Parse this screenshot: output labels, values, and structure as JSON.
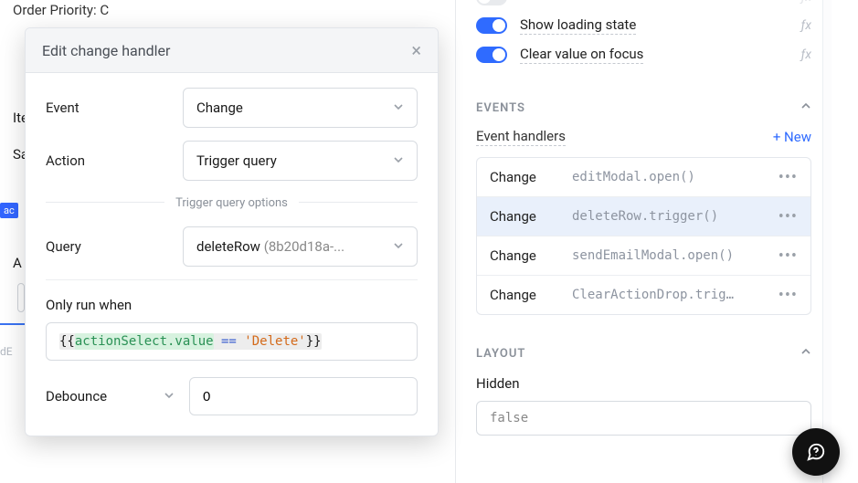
{
  "background": {
    "order_priority": "Order Priority: C",
    "label_ite": "Ite",
    "label_sa": "Sa",
    "chip": "ac",
    "label_a": "A",
    "faded": "dE"
  },
  "modal": {
    "title": "Edit change handler",
    "event_label": "Event",
    "event_value": "Change",
    "action_label": "Action",
    "action_value": "Trigger query",
    "options_header": "Trigger query options",
    "query_label": "Query",
    "query_name": "deleteRow",
    "query_id": "(8b20d18a-...",
    "only_run_label": "Only run when",
    "condition_prefix": "{{",
    "condition_ref": "actionSelect.value",
    "condition_eq": " == ",
    "condition_str": "'Delete'",
    "condition_suffix": "}}",
    "debounce_label": "Debounce",
    "debounce_value": "0"
  },
  "inspector": {
    "toggles": {
      "hide_clear": {
        "label": ""
      },
      "show_loading": {
        "label": "Show loading state"
      },
      "clear_focus": {
        "label": "Clear value on focus"
      }
    },
    "events_header": "EVENTS",
    "handlers_label": "Event handlers",
    "new_label": "+ New",
    "handlers": [
      {
        "event": "Change",
        "action": "editModal.open()"
      },
      {
        "event": "Change",
        "action": "deleteRow.trigger()"
      },
      {
        "event": "Change",
        "action": "sendEmailModal.open()"
      },
      {
        "event": "Change",
        "action": "ClearActionDrop.trig…"
      }
    ],
    "layout_header": "LAYOUT",
    "hidden_label": "Hidden",
    "hidden_value": "false"
  }
}
